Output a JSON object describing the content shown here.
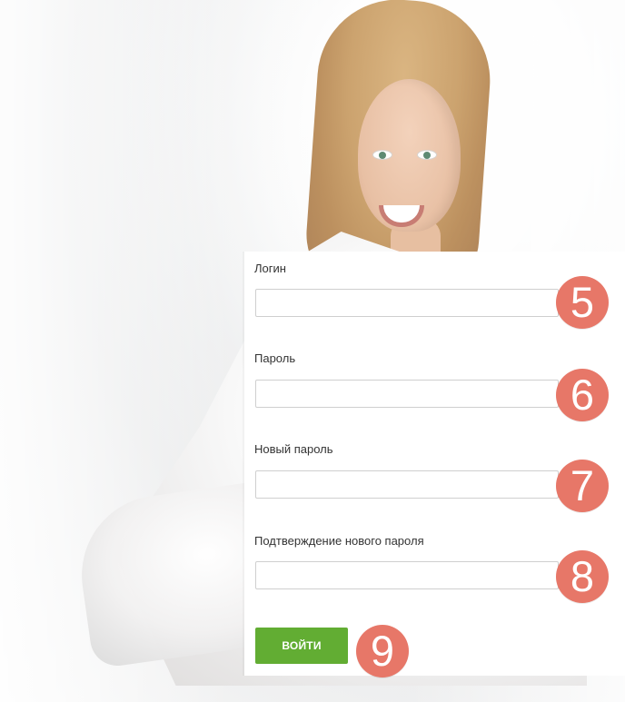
{
  "form": {
    "fields": [
      {
        "label": "Логин",
        "value": "",
        "placeholder": ""
      },
      {
        "label": "Пароль",
        "value": "",
        "placeholder": ""
      },
      {
        "label": "Новый пароль",
        "value": "",
        "placeholder": ""
      },
      {
        "label": "Подтверждение нового пароля",
        "value": "",
        "placeholder": ""
      }
    ],
    "submit_label": "ВОЙТИ"
  },
  "markers": [
    "5",
    "6",
    "7",
    "8",
    "9"
  ],
  "colors": {
    "button_green": "#62AD33",
    "marker_red": "#E77768",
    "input_border": "#CFCFCF",
    "text": "#333333"
  }
}
